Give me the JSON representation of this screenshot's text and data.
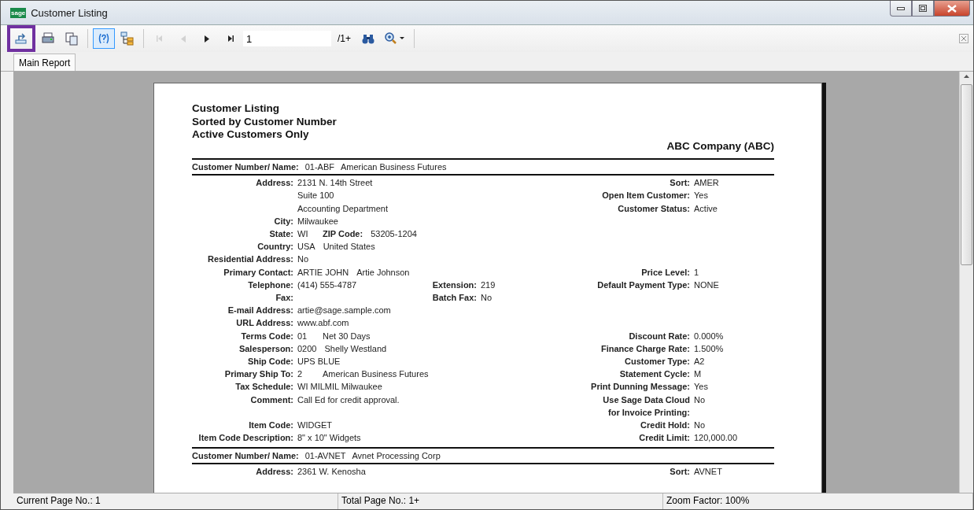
{
  "window": {
    "title": "Customer Listing",
    "logo": "sage"
  },
  "toolbar": {
    "groups": [
      [
        {
          "kind": "export",
          "disabled": false,
          "on": false,
          "highlighted": true
        },
        {
          "kind": "print",
          "disabled": false,
          "on": false,
          "highlighted": false
        },
        {
          "kind": "copy",
          "disabled": false,
          "on": false,
          "highlighted": false
        }
      ],
      [
        {
          "kind": "help",
          "disabled": false,
          "on": true,
          "highlighted": false
        },
        {
          "kind": "tree",
          "disabled": false,
          "on": false,
          "highlighted": false
        }
      ],
      [
        {
          "kind": "first",
          "disabled": true,
          "on": false,
          "highlighted": false
        },
        {
          "kind": "previous",
          "disabled": true,
          "on": false,
          "highlighted": false
        },
        {
          "kind": "next",
          "disabled": false,
          "on": false,
          "highlighted": false
        },
        {
          "kind": "last",
          "disabled": false,
          "on": false,
          "highlighted": false
        }
      ]
    ],
    "page_field": "1",
    "page_total": "/1+",
    "search_buttons": [
      {
        "kind": "find",
        "disabled": false,
        "on": false,
        "highlighted": false
      },
      {
        "kind": "zoom",
        "disabled": false,
        "on": false,
        "highlighted": false
      }
    ]
  },
  "tabs": [
    {
      "label": "Main Report",
      "selected": true
    }
  ],
  "report": {
    "title_lines": [
      "Customer Listing",
      "Sorted by Customer Number",
      "Active Customers Only"
    ],
    "company": "ABC Company (ABC)",
    "customers": [
      {
        "heading_label": "Customer Number/ Name:",
        "number": "01-ABF",
        "name": "American Business Futures",
        "rows": [
          {
            "left": {
              "label": "Address:",
              "values": [
                {
                  "text": "2131 N. 14th Street",
                  "kind": "value"
                }
              ]
            },
            "right": {
              "label": "Sort:",
              "value": "AMER"
            }
          },
          {
            "left": {
              "values": [
                {
                  "text": "Suite 100",
                  "kind": "value"
                }
              ]
            },
            "right": {
              "label": "Open Item Customer:",
              "value": "Yes"
            }
          },
          {
            "left": {
              "values": [
                {
                  "text": "Accounting Department",
                  "kind": "value"
                }
              ]
            },
            "right": {
              "label": "Customer Status:",
              "value": "Active"
            }
          },
          {
            "left": {
              "label": "City:",
              "values": [
                {
                  "text": "Milwaukee",
                  "kind": "value"
                }
              ]
            }
          },
          {
            "left": {
              "label": "State:",
              "values": [
                {
                  "text": "WI",
                  "kind": "value"
                },
                {
                  "text": "ZIP Code:",
                  "kind": "label"
                },
                {
                  "text": "53205-1204",
                  "kind": "value"
                }
              ]
            }
          },
          {
            "left": {
              "label": "Country:",
              "values": [
                {
                  "text": "USA",
                  "kind": "value"
                },
                {
                  "text": "United States",
                  "kind": "value"
                }
              ]
            }
          },
          {
            "left": {
              "label": "Residential Address:",
              "values": [
                {
                  "text": "No",
                  "kind": "value"
                }
              ]
            }
          },
          {
            "left": {
              "label": "Primary Contact:",
              "values": [
                {
                  "text": "ARTIE JOHN",
                  "kind": "value"
                },
                {
                  "text": "Artie Johnson",
                  "kind": "value"
                }
              ]
            },
            "right": {
              "label": "Price Level:",
              "value": "1"
            }
          },
          {
            "left": {
              "label": "Telephone:",
              "values": [
                {
                  "text": "(414) 555-4787",
                  "kind": "value"
                }
              ]
            },
            "mid": {
              "label": "Extension:",
              "value": "219"
            },
            "right": {
              "label": "Default Payment Type:",
              "value": "NONE"
            }
          },
          {
            "left": {
              "label": "Fax:"
            },
            "mid": {
              "label": "Batch Fax:",
              "value": "No"
            }
          },
          {
            "left": {
              "label": "E-mail Address:",
              "values": [
                {
                  "text": "artie@sage.sample.com",
                  "kind": "value"
                }
              ]
            }
          },
          {
            "left": {
              "label": "URL Address:",
              "values": [
                {
                  "text": "www.abf.com",
                  "kind": "value"
                }
              ]
            }
          },
          {
            "left": {
              "label": "Terms Code:",
              "values": [
                {
                  "text": "01",
                  "kind": "value"
                },
                {
                  "text": "Net 30 Days",
                  "kind": "value"
                }
              ]
            },
            "right": {
              "label": "Discount Rate:",
              "value": "0.000%"
            }
          },
          {
            "left": {
              "label": "Salesperson:",
              "values": [
                {
                  "text": "0200",
                  "kind": "value"
                },
                {
                  "text": "Shelly Westland",
                  "kind": "value"
                }
              ]
            },
            "right": {
              "label": "Finance Charge Rate:",
              "value": "1.500%"
            }
          },
          {
            "left": {
              "label": "Ship Code:",
              "values": [
                {
                  "text": "UPS BLUE",
                  "kind": "value"
                }
              ]
            },
            "right": {
              "label": "Customer Type:",
              "value": "A2"
            }
          },
          {
            "left": {
              "label": "Primary Ship To:",
              "values": [
                {
                  "text": "2",
                  "kind": "value"
                },
                {
                  "text": "American Business Futures",
                  "kind": "value"
                }
              ]
            },
            "right": {
              "label": "Statement Cycle:",
              "value": "M"
            }
          },
          {
            "left": {
              "label": "Tax Schedule:",
              "values": [
                {
                  "text": "WI MILMIL Milwaukee",
                  "kind": "value"
                }
              ]
            },
            "right": {
              "label": "Print Dunning Message:",
              "value": "Yes"
            }
          },
          {
            "left": {
              "label": "Comment:",
              "values": [
                {
                  "text": "Call Ed for credit approval.",
                  "kind": "value"
                }
              ]
            },
            "right": {
              "label": "Use Sage Data Cloud\nfor Invoice Printing:",
              "value": "No"
            }
          },
          {
            "left": {
              "label": "Item Code:",
              "values": [
                {
                  "text": "WIDGET",
                  "kind": "value"
                }
              ]
            },
            "right": {
              "label": "Credit Hold:",
              "value": "No"
            }
          },
          {
            "left": {
              "label": "Item Code Description:",
              "values": [
                {
                  "text": "8\" x 10\" Widgets",
                  "kind": "value"
                }
              ]
            },
            "right": {
              "label": "Credit Limit:",
              "value": "120,000.00"
            }
          }
        ]
      },
      {
        "heading_label": "Customer Number/ Name:",
        "number": "01-AVNET",
        "name": "Avnet Processing Corp",
        "rows": [
          {
            "left": {
              "label": "Address:",
              "values": [
                {
                  "text": "2361 W. Kenosha",
                  "kind": "value"
                }
              ]
            },
            "right": {
              "label": "Sort:",
              "value": "AVNET"
            }
          }
        ]
      }
    ]
  },
  "status_bar": [
    "Current Page No.: 1",
    "Total Page No.: 1+",
    "Zoom Factor: 100%"
  ]
}
